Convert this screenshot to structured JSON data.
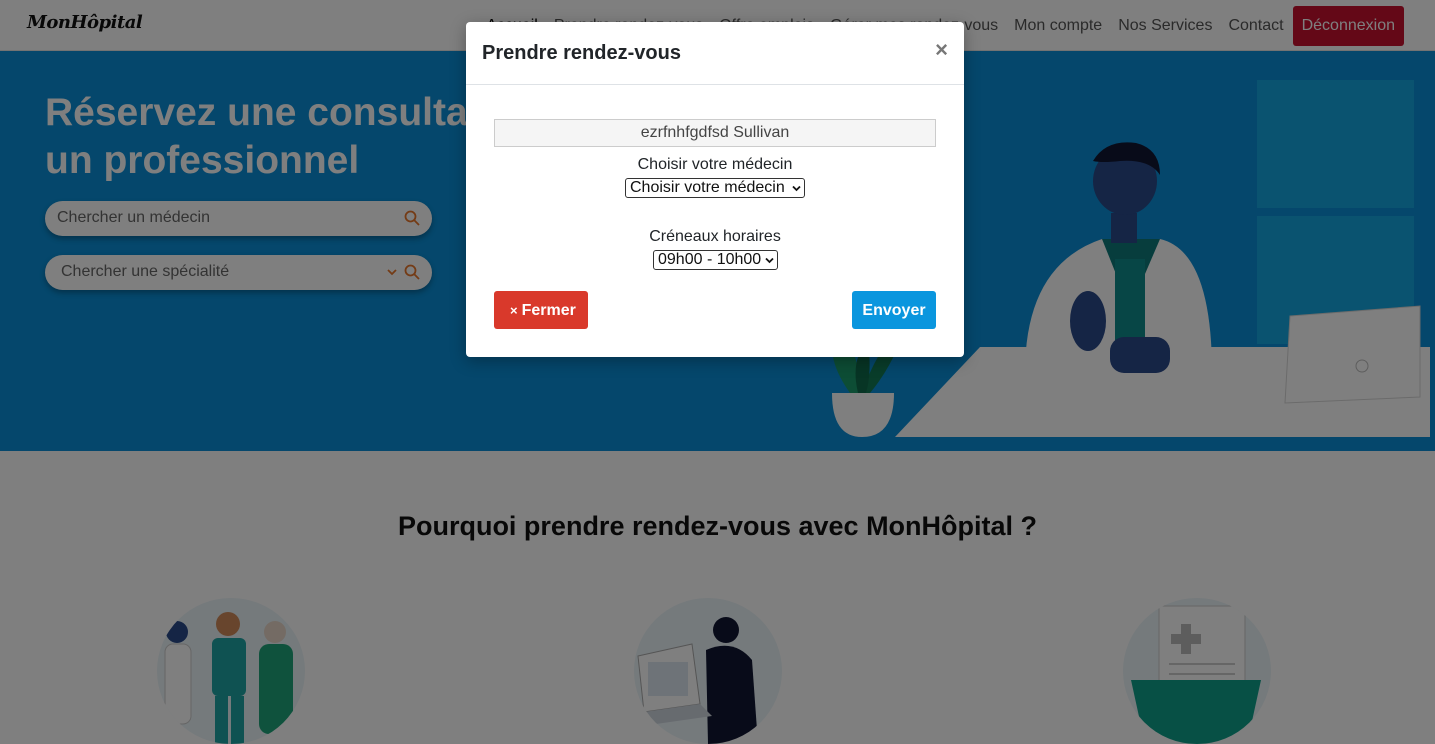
{
  "navbar": {
    "logo": "MonHôpital",
    "links": [
      "Accueil",
      "Prendre rendez-vous",
      "Offre emplois",
      "Gérer mes rendez-vous",
      "Mon compte",
      "Nos Services",
      "Contact"
    ],
    "logout_label": "Déconnexion"
  },
  "hero": {
    "title": "Réservez une consultation chez un professionnel",
    "search_doctor_placeholder": "Chercher un médecin",
    "search_specialty_placeholder": "Chercher une spécialité"
  },
  "section2": {
    "title": "Pourquoi prendre rendez-vous avec MonHôpital ?"
  },
  "modal": {
    "title": "Prendre rendez-vous",
    "close_symbol": "×",
    "patient_name": "ezrfnhfgdfsd Sullivan",
    "doctor_label": "Choisir votre médecin",
    "doctor_selected": "Choisir votre médecin",
    "slot_label": "Créneaux horaires",
    "slot_selected": "09h00 - 10h00",
    "close_button_icon": "×",
    "close_button_label": "Fermer",
    "send_button_label": "Envoyer"
  },
  "colors": {
    "hero_bg": "#0a8fd8",
    "logout_bg": "#c8102e",
    "close_btn_bg": "#d9392b",
    "send_btn_bg": "#0a96de"
  },
  "icons": [
    "search-icon",
    "chevron-down-icon",
    "close-icon"
  ]
}
